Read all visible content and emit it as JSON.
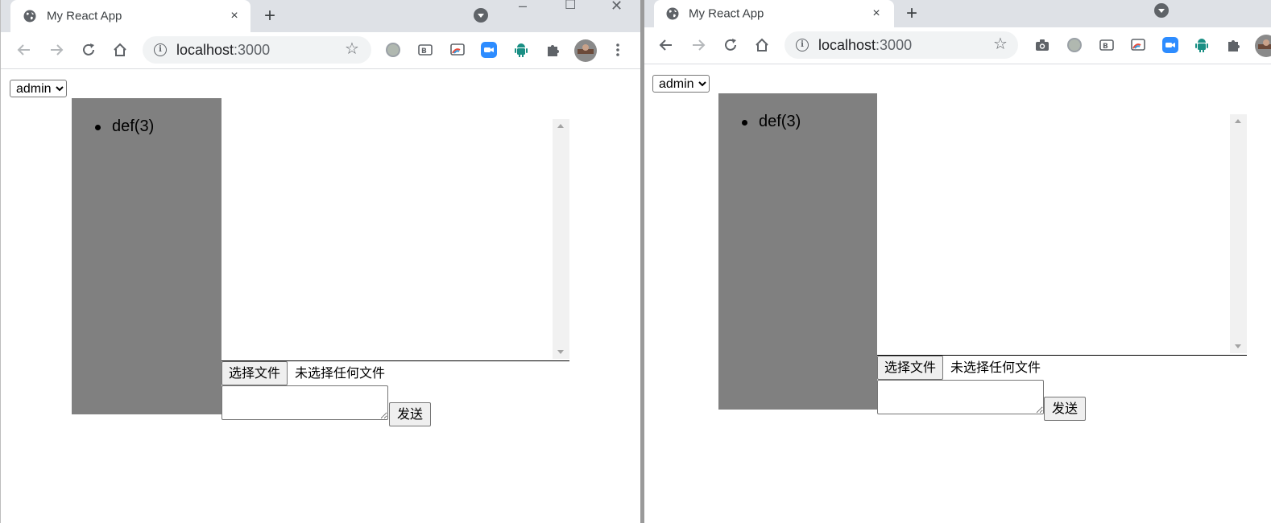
{
  "windows": [
    {
      "tab": {
        "title": "My React App",
        "close": "×"
      },
      "new_tab": "+",
      "window_controls": {
        "minimize": "–",
        "maximize": "☐",
        "close": "✕"
      },
      "address": {
        "host": "localhost",
        "port": ":3000"
      },
      "extensions": [
        "gray-circle-extension-icon",
        "bilibili-extension-icon",
        "cast-extension-icon",
        "zoom-extension-icon",
        "android-extension-icon",
        "puzzle-extensions-icon",
        "profile-avatar",
        "menu-kebab-icon"
      ],
      "app": {
        "user_select": {
          "value": "admin"
        },
        "rooms": [
          "def(3)"
        ],
        "file_button": "选择文件",
        "file_status": "未选择任何文件",
        "send_button": "发送",
        "message_value": ""
      }
    },
    {
      "tab": {
        "title": "My React App",
        "close": "×"
      },
      "new_tab": "+",
      "address": {
        "host": "localhost",
        "port": ":3000"
      },
      "extensions": [
        "camera-extension-icon",
        "gray-circle-extension-icon",
        "bilibili-extension-icon",
        "cast-extension-icon",
        "zoom-extension-icon",
        "android-extension-icon",
        "puzzle-extensions-icon",
        "profile-avatar"
      ],
      "app": {
        "user_select": {
          "value": "admin"
        },
        "rooms": [
          "def(3)"
        ],
        "file_button": "选择文件",
        "file_status": "未选择任何文件",
        "send_button": "发送",
        "message_value": ""
      }
    }
  ],
  "colors": {
    "tabstrip": "#dee1e6",
    "omnibox": "#f1f3f4",
    "sidebar": "#808080",
    "icon": "#5f6368",
    "zoom_blue": "#2d8cff",
    "android_green": "#1a8f84"
  }
}
